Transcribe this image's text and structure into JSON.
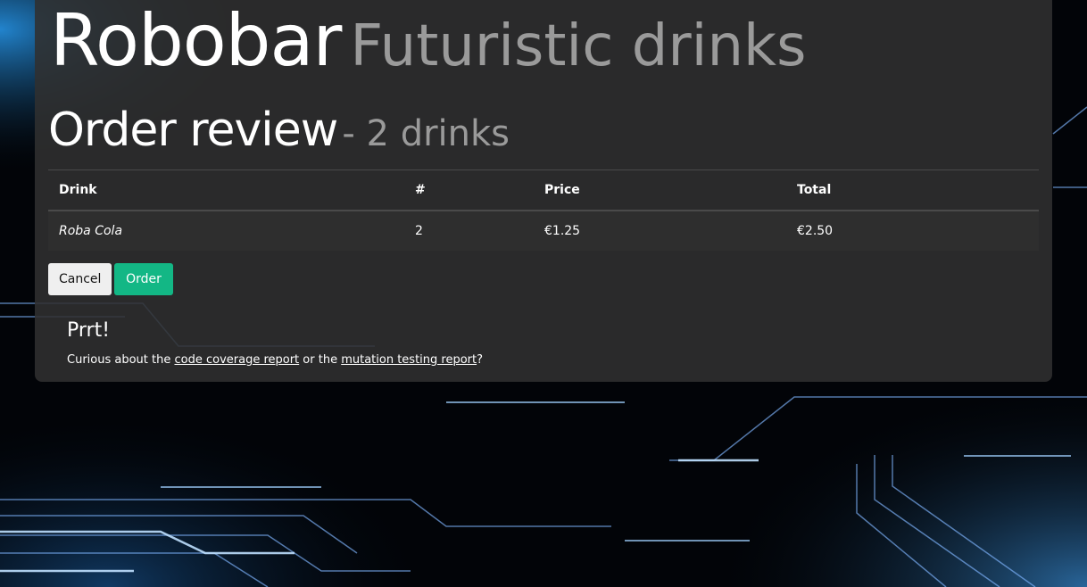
{
  "brand": {
    "title": "Robobar",
    "subtitle": "Futuristic drinks"
  },
  "review": {
    "title": "Order review",
    "subtitle": "- 2 drinks"
  },
  "table": {
    "headers": [
      "Drink",
      "#",
      "Price",
      "Total"
    ],
    "rows": [
      {
        "drink": "Roba Cola",
        "qty": "2",
        "price": "€1.25",
        "total": "€2.50"
      }
    ]
  },
  "actions": {
    "cancel_label": "Cancel",
    "order_label": "Order"
  },
  "footer": {
    "title": "Prrt!",
    "text_before": "Curious about the ",
    "link1": "code coverage report",
    "text_middle": " or the ",
    "link2": "mutation testing report",
    "text_after": "?"
  },
  "colors": {
    "card_background": "#303030",
    "order_button": "#13b785",
    "cancel_button": "#efefef",
    "muted_text": "#9a9a9a"
  }
}
